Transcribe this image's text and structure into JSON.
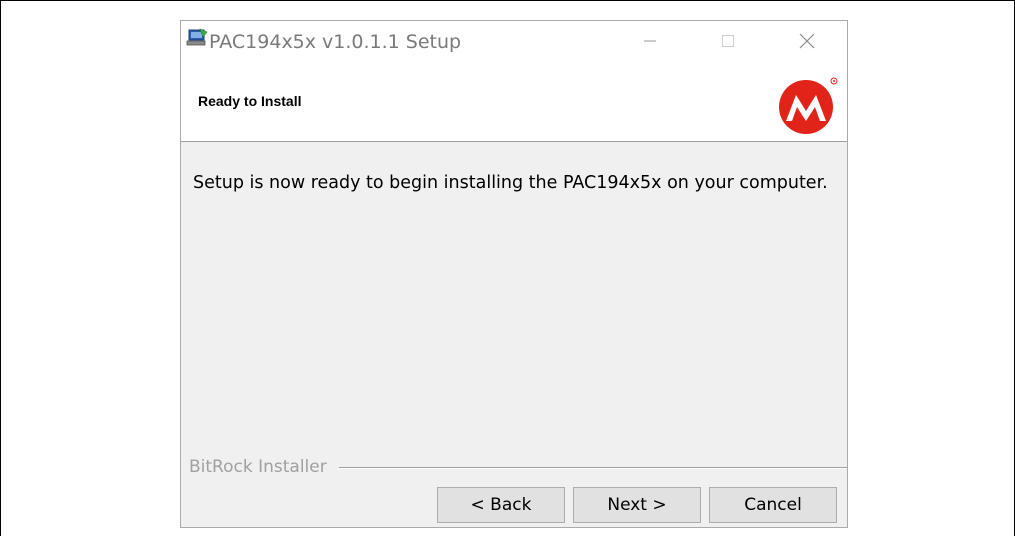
{
  "window": {
    "title": "PAC194x5x v1.0.1.1 Setup",
    "icon": "installer-computer-icon",
    "controls": {
      "minimize_icon": "minimize-icon",
      "maximize_icon": "maximize-icon",
      "close_icon": "close-icon"
    }
  },
  "header": {
    "title": "Ready to Install",
    "logo": "microchip-logo"
  },
  "content": {
    "message": "Setup is now ready to begin installing the PAC194x5x on your computer."
  },
  "footer": {
    "brand": "BitRock Installer",
    "buttons": {
      "back": "< Back",
      "next": "Next >",
      "cancel": "Cancel"
    }
  },
  "colors": {
    "logo_red": "#e2231a",
    "dialog_bg": "#f0f0f0",
    "button_bg": "#e1e1e1"
  }
}
